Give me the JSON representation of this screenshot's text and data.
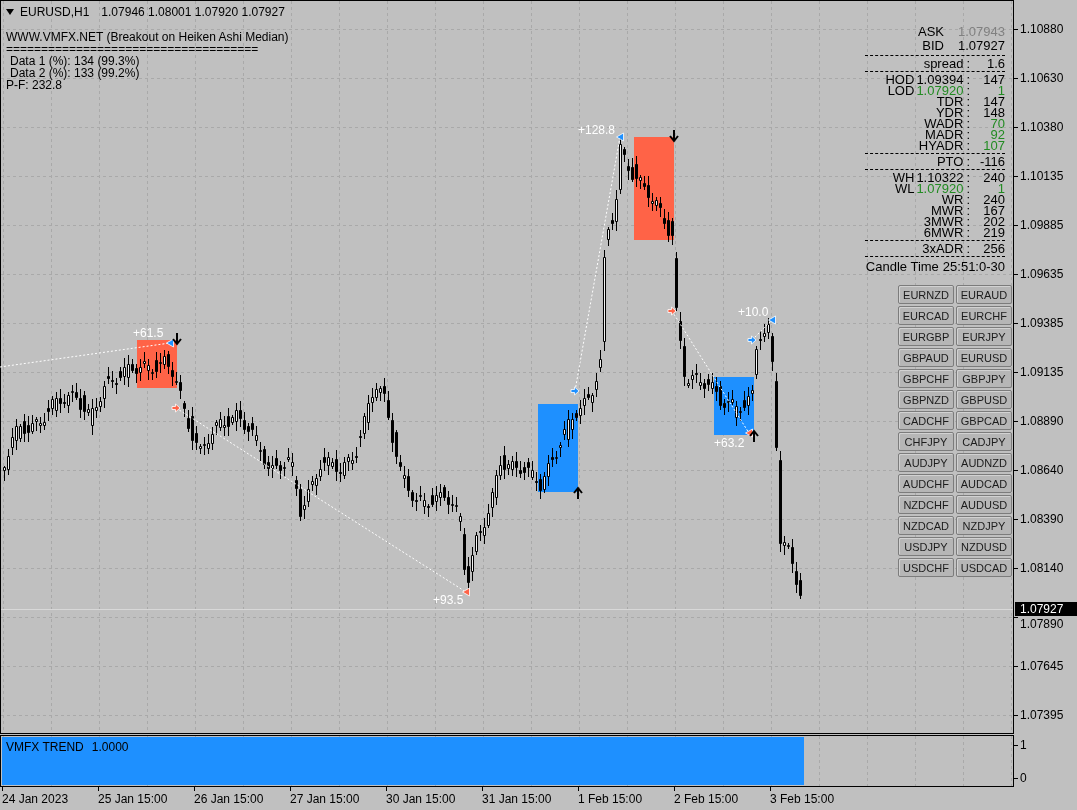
{
  "chart": {
    "symbol": "EURUSD,H1",
    "ohlc": "1.07946 1.08001 1.07920 1.07927",
    "indicator": {
      "title": "WWW.VMFX.NET (Breakout on Heiken Ashi Median)",
      "separator": "====================================",
      "lines": [
        {
          "kind": "stat",
          "text": "Data 1 (%): 134 (99.3%)"
        },
        {
          "kind": "stat",
          "text": "Data 2 (%): 133 (99.2%)"
        },
        {
          "kind": "total",
          "text": "P-F: 232.8"
        }
      ]
    },
    "breakout_boxes": [
      {
        "kind": "sell"
      },
      {
        "kind": "buy"
      },
      {
        "kind": "sell"
      },
      {
        "kind": "buy"
      }
    ],
    "trades": [
      {
        "kind": "buy",
        "profit": "+61.5"
      },
      {
        "kind": "sell",
        "profit": "+93.5"
      },
      {
        "kind": "buy",
        "profit": "+128.8"
      },
      {
        "kind": "sell",
        "profit": "+63.2"
      },
      {
        "kind": "buy",
        "profit": "+10.0"
      }
    ]
  },
  "stats_panel": {
    "rows": [
      {
        "kind": "quote",
        "label": "ASK",
        "value": "1.07943",
        "color": "#808080"
      },
      {
        "kind": "quote",
        "label": "BID",
        "value": "1.07927",
        "color": "#000000"
      },
      {
        "kind": "divider"
      },
      {
        "kind": "stat",
        "label": "spread",
        "separator": ":",
        "value": "1.6",
        "color": "#000000"
      },
      {
        "kind": "divider"
      },
      {
        "kind": "stat",
        "label": "HOD",
        "price": "1.09394",
        "separator": ":",
        "value": "147",
        "color": "#000000"
      },
      {
        "kind": "stat",
        "label": "LOD",
        "price": "1.07920",
        "separator": ":",
        "value": "1",
        "color": "#228b22"
      },
      {
        "kind": "stat",
        "label": "TDR",
        "separator": ":",
        "value": "147",
        "color": "#000000"
      },
      {
        "kind": "stat",
        "label": "YDR",
        "separator": ":",
        "value": "148",
        "color": "#000000"
      },
      {
        "kind": "stat",
        "label": "WADR",
        "separator": ":",
        "value": "70",
        "color": "#228b22"
      },
      {
        "kind": "stat",
        "label": "MADR",
        "separator": ":",
        "value": "92",
        "color": "#228b22"
      },
      {
        "kind": "stat",
        "label": "HYADR",
        "separator": ":",
        "value": "107",
        "color": "#228b22"
      },
      {
        "kind": "divider"
      },
      {
        "kind": "stat",
        "label": "PTO",
        "separator": ":",
        "value": "-116",
        "color": "#000000"
      },
      {
        "kind": "divider"
      },
      {
        "kind": "stat",
        "label": "WH",
        "price": "1.10322",
        "separator": ":",
        "value": "240",
        "color": "#000000"
      },
      {
        "kind": "stat",
        "label": "WL",
        "price": "1.07920",
        "separator": ":",
        "value": "1",
        "color": "#228b22"
      },
      {
        "kind": "stat",
        "label": "WR",
        "separator": ":",
        "value": "240",
        "color": "#000000"
      },
      {
        "kind": "stat",
        "label": "MWR",
        "separator": ":",
        "value": "167",
        "color": "#000000"
      },
      {
        "kind": "stat",
        "label": "3MWR",
        "separator": ":",
        "value": "202",
        "color": "#000000"
      },
      {
        "kind": "stat",
        "label": "6MWR",
        "separator": ":",
        "value": "219",
        "color": "#000000"
      },
      {
        "kind": "divider"
      },
      {
        "kind": "stat",
        "label": "3xADR",
        "separator": ":",
        "value": "256",
        "color": "#000000"
      },
      {
        "kind": "divider"
      },
      {
        "kind": "timer",
        "label": "Candle Time",
        "value": "25:51:0-30"
      }
    ]
  },
  "symbol_buttons": [
    "EURNZD",
    "EURAUD",
    "EURCAD",
    "EURCHF",
    "EURGBP",
    "EURJPY",
    "GBPAUD",
    "EURUSD",
    "GBPCHF",
    "GBPJPY",
    "GBPNZD",
    "GBPUSD",
    "CADCHF",
    "GBPCAD",
    "CHFJPY",
    "CADJPY",
    "AUDJPY",
    "AUDNZD",
    "AUDCHF",
    "AUDCAD",
    "NZDCHF",
    "AUDUSD",
    "NZDCAD",
    "NZDJPY",
    "USDJPY",
    "NZDUSD",
    "USDCHF",
    "USDCAD"
  ],
  "price_axis": {
    "labels": [
      "1.10880",
      "1.10630",
      "1.10380",
      "1.10135",
      "1.09885",
      "1.09635",
      "1.09385",
      "1.09135",
      "1.08890",
      "1.08640",
      "1.08390",
      "1.08140",
      "1.07890",
      "1.07645",
      "1.07395"
    ],
    "current_price": "1.07927"
  },
  "trend_window": {
    "label": "VMFX TREND",
    "value": "1.0000",
    "axis_labels": [
      "1",
      "0"
    ]
  },
  "time_axis": {
    "labels": [
      "24 Jan 2023",
      "25 Jan 15:00",
      "26 Jan 15:00",
      "27 Jan 15:00",
      "30 Jan 15:00",
      "31 Jan 15:00",
      "1 Feb 15:00",
      "2 Feb 15:00",
      "3 Feb 15:00"
    ]
  }
}
